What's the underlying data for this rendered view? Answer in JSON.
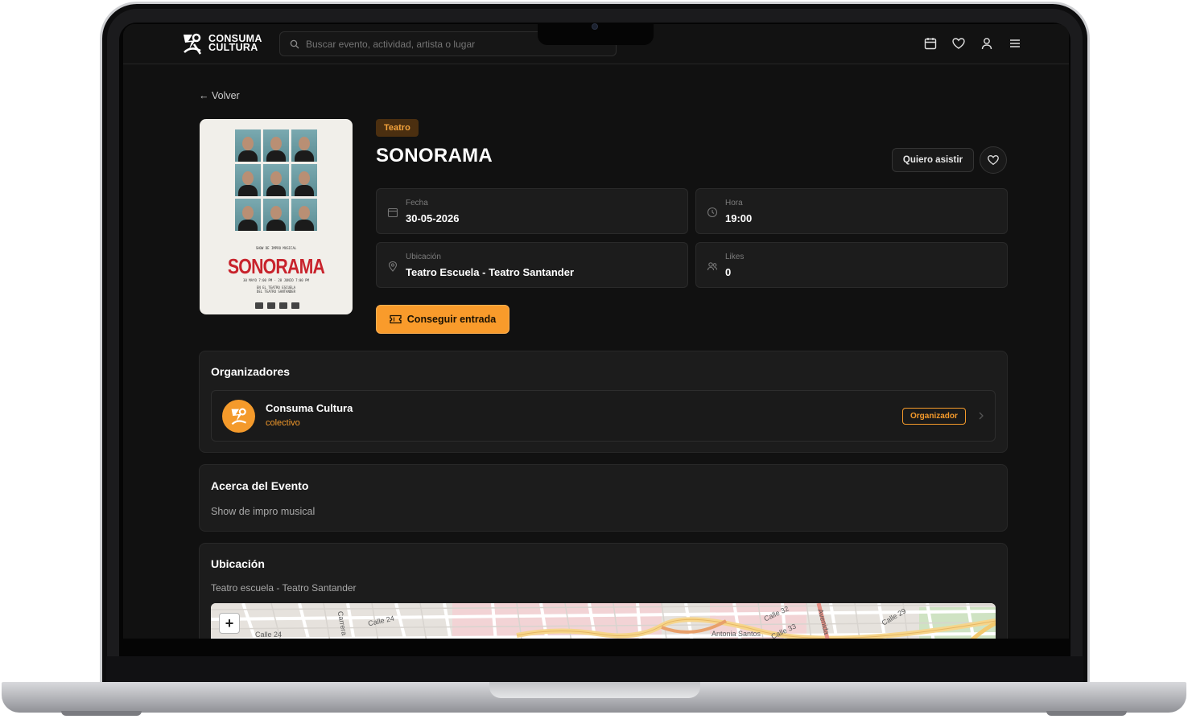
{
  "app": {
    "logo_line1": "CONSUMA",
    "logo_line2": "CULTURA"
  },
  "search": {
    "placeholder": "Buscar evento, actividad, artista o lugar"
  },
  "topbar_icons": [
    "calendar-icon",
    "heart-icon",
    "user-icon",
    "menu-icon"
  ],
  "back_label": "← Volver",
  "poster": {
    "subtitle": "SHOW DE IMPRO MUSICAL",
    "title": "SONORAMA",
    "dates": "30 MAYO 7:00 PM · 28 JUNIO 7:00 PM",
    "venue_line1": "EN EL TEATRO ESCUELA",
    "venue_line2": "DEL TEATRO SANTANDER"
  },
  "event": {
    "category": "Teatro",
    "title": "SONORAMA",
    "attend_label": "Quiero asistir",
    "ticket_label": "Conseguir entrada",
    "info": {
      "date_label": "Fecha",
      "date_value": "30-05-2026",
      "time_label": "Hora",
      "time_value": "19:00",
      "location_label": "Ubicación",
      "location_value": "Teatro Escuela - Teatro Santander",
      "likes_label": "Likes",
      "likes_value": "0"
    }
  },
  "organizers": {
    "heading": "Organizadores",
    "items": [
      {
        "name": "Consuma Cultura",
        "type": "colectivo",
        "role": "Organizador"
      }
    ]
  },
  "about": {
    "heading": "Acerca del Evento",
    "description": "Show de impro musical"
  },
  "location_section": {
    "heading": "Ubicación",
    "address": "Teatro escuela - Teatro Santander",
    "zoom_in": "+",
    "map_labels": [
      "Calle 24",
      "Calle 24",
      "Carrera",
      "Calle 32",
      "Calle 33",
      "Antonia Santos",
      "Avenida",
      "Calle 29"
    ]
  },
  "colors": {
    "accent": "#f99b2b",
    "background": "#111111",
    "card": "#1c1c1c"
  }
}
